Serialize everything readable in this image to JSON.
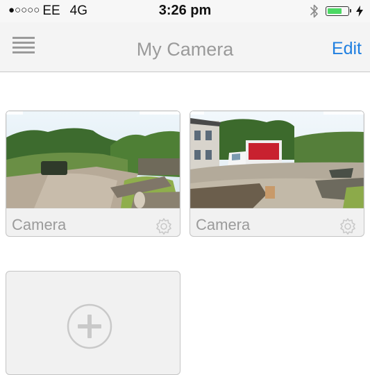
{
  "status_bar": {
    "signal_dots": "●○○○○",
    "carrier": "EE",
    "network": "4G",
    "time": "3:26 pm",
    "battery_level": 0.72,
    "icons": [
      "bluetooth-icon",
      "battery-icon",
      "charging-bolt-icon"
    ]
  },
  "nav": {
    "menu_icon": "hamburger-menu-icon",
    "title": "My Camera",
    "edit_label": "Edit"
  },
  "cameras": [
    {
      "name": "Camera",
      "settings_icon": "gear-icon"
    },
    {
      "name": "Camera",
      "settings_icon": "gear-icon"
    }
  ],
  "add_camera": {
    "icon": "plus-circle-icon"
  },
  "colors": {
    "accent": "#1f7fe0",
    "title_gray": "#9a9a9a",
    "battery_green": "#4cd964",
    "card_background": "#f1f1f1"
  }
}
